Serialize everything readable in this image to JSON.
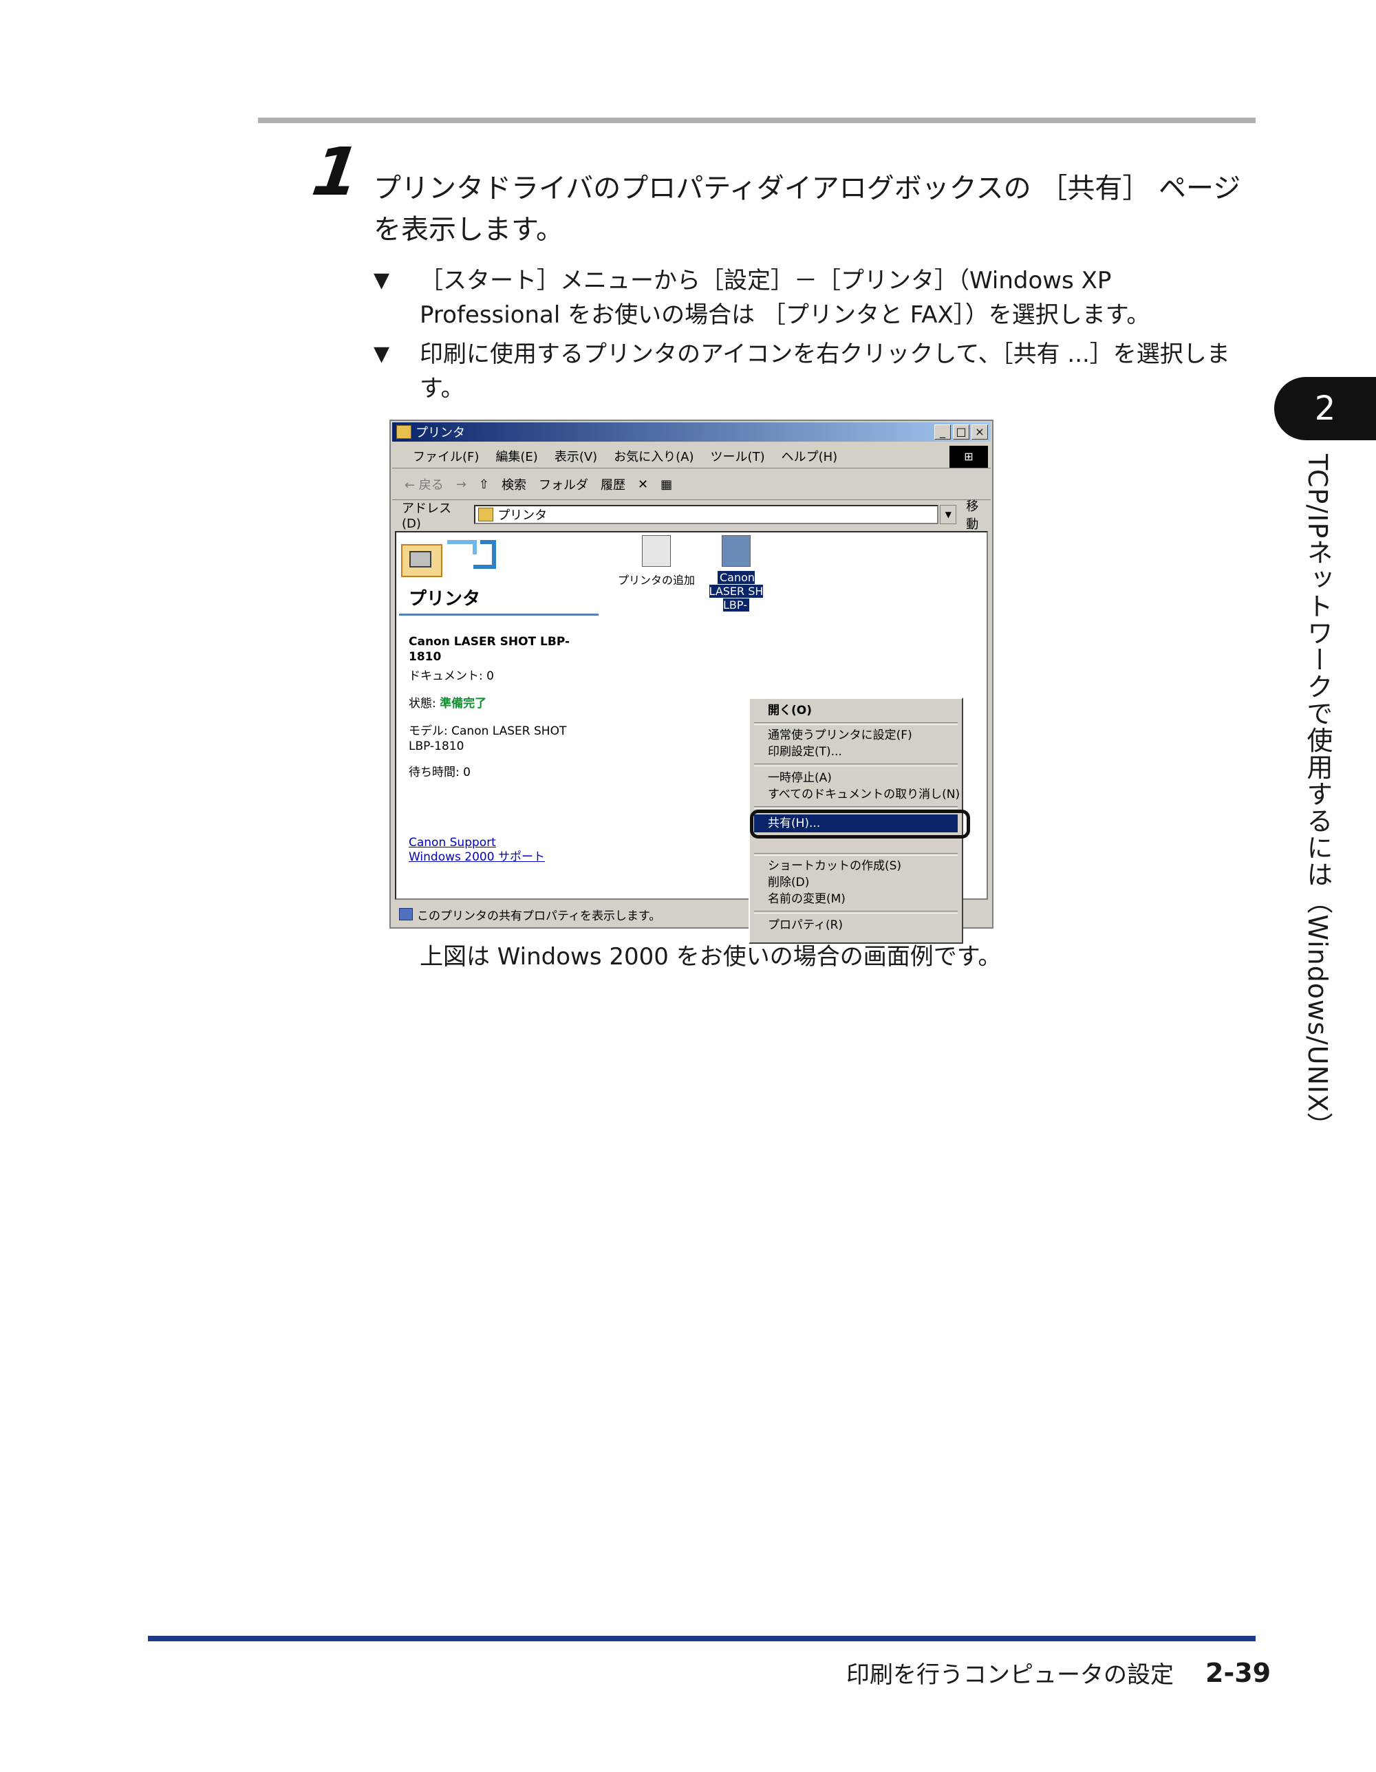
{
  "step": {
    "number": "1",
    "text": "プリンタドライバのプロパティダイアログボックスの ［共有］ ページを表示します。"
  },
  "bullets": [
    {
      "mark": "▼",
      "text": "［スタート］メニューから［設定］－［プリンタ］（Windows XP Professional をお使いの場合は ［プリンタと FAX］）を選択します。"
    },
    {
      "mark": "▼",
      "text": "印刷に使用するプリンタのアイコンを右クリックして、［共有 ...］を選択します。"
    }
  ],
  "window": {
    "title": "プリンタ",
    "title_buttons": [
      "_",
      "□",
      "×"
    ],
    "menu": [
      "ファイル(F)",
      "編集(E)",
      "表示(V)",
      "お気に入り(A)",
      "ツール(T)",
      "ヘルプ(H)"
    ],
    "toolbar": [
      "← 戻る",
      "→",
      "⇧",
      "検索",
      "フォルダ",
      "履歴",
      "✕",
      "▦"
    ],
    "address_label": "アドレス(D)",
    "address_value": "プリンタ",
    "go_label": "移動",
    "left_pane": {
      "title": "プリンタ",
      "printer_name": "Canon LASER SHOT LBP-1810",
      "documents": "ドキュメント: 0",
      "status_label": "状態:",
      "status_value": "準備完了",
      "model": "モデル: Canon LASER SHOT LBP-1810",
      "wait_time": "待ち時間: 0",
      "links": [
        "Canon Support",
        "Windows 2000 サポート"
      ]
    },
    "icons": [
      {
        "label": "プリンタの追加"
      },
      {
        "label": "Canon LASER SH LBP-"
      }
    ],
    "context_menu": {
      "items": [
        "開く(O)",
        "通常使うプリンタに設定(F)",
        "印刷設定(T)...",
        "一時停止(A)",
        "すべてのドキュメントの取り消し(N)",
        "共有(H)...",
        "ショートカットの作成(S)",
        "削除(D)",
        "名前の変更(M)",
        "プロパティ(R)"
      ]
    },
    "status_text": "このプリンタの共有プロパティを表示します。"
  },
  "caption": "上図は Windows 2000 をお使いの場合の画面例です。",
  "chapter": {
    "number": "2",
    "title": "TCP/IPネットワークで使用するには（Windows/UNIX）"
  },
  "footer": {
    "title": "印刷を行うコンピュータの設定",
    "page": "2-39"
  }
}
